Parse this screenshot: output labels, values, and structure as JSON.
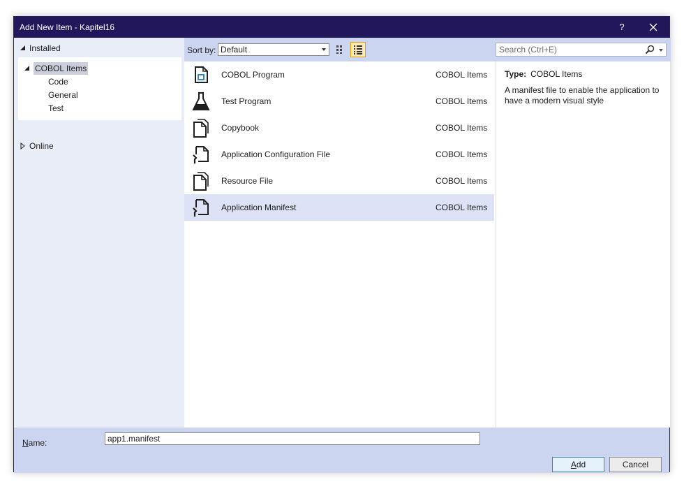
{
  "window": {
    "title": "Add New Item - Kapitel16",
    "help_label": "?"
  },
  "tree": {
    "installed_label": "Installed",
    "cobol_items_label": "COBOL Items",
    "children": [
      "Code",
      "General",
      "Test"
    ],
    "online_label": "Online"
  },
  "toolbar": {
    "sort_label": "Sort by:",
    "sort_value": "Default"
  },
  "items": [
    {
      "name": "COBOL Program",
      "category": "COBOL Items",
      "icon": "cobol-program-icon"
    },
    {
      "name": "Test Program",
      "category": "COBOL Items",
      "icon": "flask-icon"
    },
    {
      "name": "Copybook",
      "category": "COBOL Items",
      "icon": "copybook-icon"
    },
    {
      "name": "Application Configuration File",
      "category": "COBOL Items",
      "icon": "config-file-icon"
    },
    {
      "name": "Resource File",
      "category": "COBOL Items",
      "icon": "resource-file-icon"
    },
    {
      "name": "Application Manifest",
      "category": "COBOL Items",
      "icon": "manifest-file-icon",
      "selected": true
    }
  ],
  "search": {
    "placeholder": "Search (Ctrl+E)"
  },
  "details": {
    "type_label": "Type:",
    "type_value": "COBOL Items",
    "description": "A manifest file to enable the application to have a modern visual style"
  },
  "footer": {
    "name_label_prefix": "N",
    "name_label_rest": "ame:",
    "name_value": "app1.manifest",
    "add_prefix": "A",
    "add_rest": "dd",
    "cancel_label": "Cancel"
  },
  "colors": {
    "titlebar": "#22175a",
    "chrome": "#ccd5f0",
    "selected_row": "#dde2f7"
  }
}
